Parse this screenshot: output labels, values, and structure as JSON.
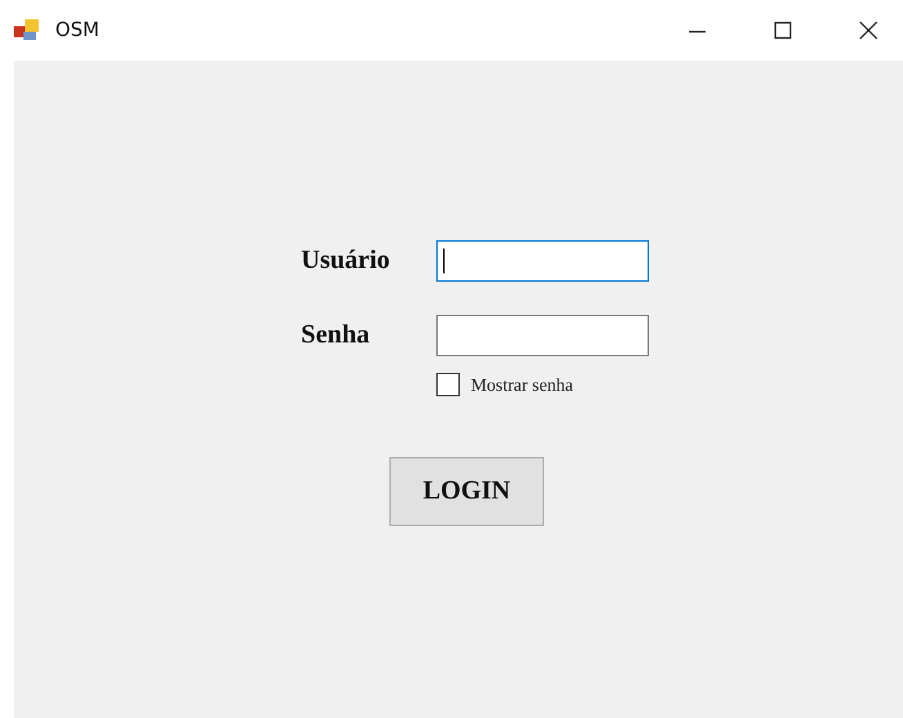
{
  "window": {
    "title": "OSM"
  },
  "fields": [
    {
      "label": "Usuário",
      "focused": true
    },
    {
      "label": "Senha",
      "focused": false
    }
  ],
  "show_password": {
    "label": "Mostrar senha",
    "checked": false
  },
  "login_button": {
    "label": "LOGIN"
  }
}
